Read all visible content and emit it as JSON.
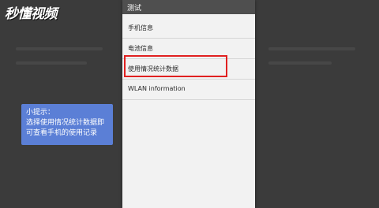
{
  "watermark": {
    "logo_text": "秒懂视频"
  },
  "phone": {
    "title": "测试",
    "menu_items": [
      {
        "label": "手机信息"
      },
      {
        "label": "电池信息"
      },
      {
        "label": "使用情况统计数据"
      },
      {
        "label": "WLAN information"
      }
    ]
  },
  "tip": {
    "title": "小提示：",
    "body": "选择使用情况统计数据即可查看手机的使用记录"
  },
  "colors": {
    "highlight": "#e02020",
    "tip_background": "#5b7fd6",
    "title_bar": "#4f4f4f"
  }
}
